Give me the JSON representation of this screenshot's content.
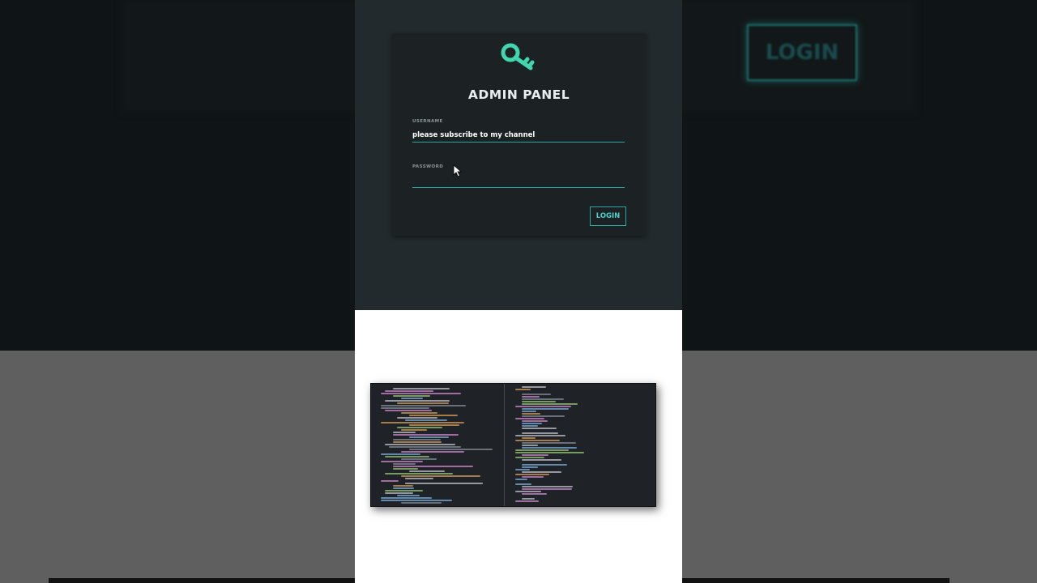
{
  "background": {
    "ghost_button_label": "LOGIN"
  },
  "login_card": {
    "title": "ADMIN PANEL",
    "icon": "key-icon",
    "username": {
      "label": "USERNAME",
      "value": "please subscribe to my channel"
    },
    "password": {
      "label": "PASSWORD",
      "value": ""
    },
    "submit_label": "LOGIN"
  },
  "code_preview": {
    "description_icon": "code-editor-screenshot"
  },
  "colors": {
    "accent": "#2aa6a3",
    "key": "#3fd6b0",
    "panel_bg": "#222a2d",
    "card_bg": "#1c2224"
  }
}
